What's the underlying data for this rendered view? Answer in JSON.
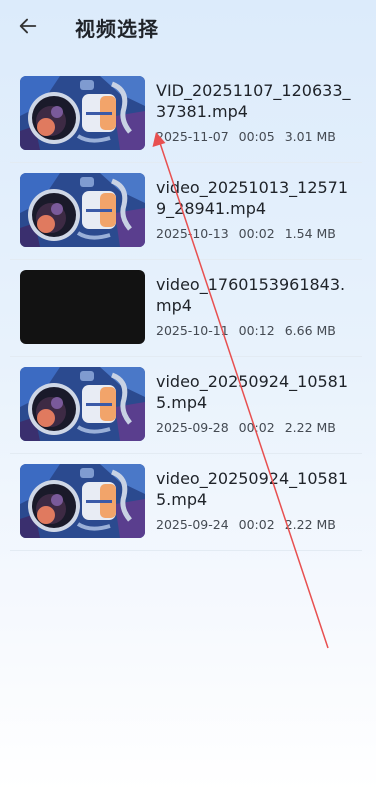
{
  "header": {
    "title": "视频选择",
    "back_icon": "arrow-left-icon"
  },
  "videos": [
    {
      "name": "VID_20251107_120633_37381.mp4",
      "date": "2025-11-07",
      "duration": "00:05",
      "size": "3.01 MB",
      "thumbnail": "astronaut-image"
    },
    {
      "name": "video_20251013_125719_28941.mp4",
      "date": "2025-10-13",
      "duration": "00:02",
      "size": "1.54 MB",
      "thumbnail": "astronaut-image"
    },
    {
      "name": "video_1760153961843.mp4",
      "date": "2025-10-11",
      "duration": "00:12",
      "size": "6.66 MB",
      "thumbnail": "black-frame"
    },
    {
      "name": "video_20250924_105815.mp4",
      "date": "2025-09-28",
      "duration": "00:02",
      "size": "2.22 MB",
      "thumbnail": "astronaut-image"
    },
    {
      "name": "video_20250924_105815.mp4",
      "date": "2025-09-24",
      "duration": "00:02",
      "size": "2.22 MB",
      "thumbnail": "astronaut-image"
    }
  ],
  "colors": {
    "annotation_arrow": "#e85050",
    "background_top": "#dcebfb",
    "background_bottom": "#ffffff"
  }
}
